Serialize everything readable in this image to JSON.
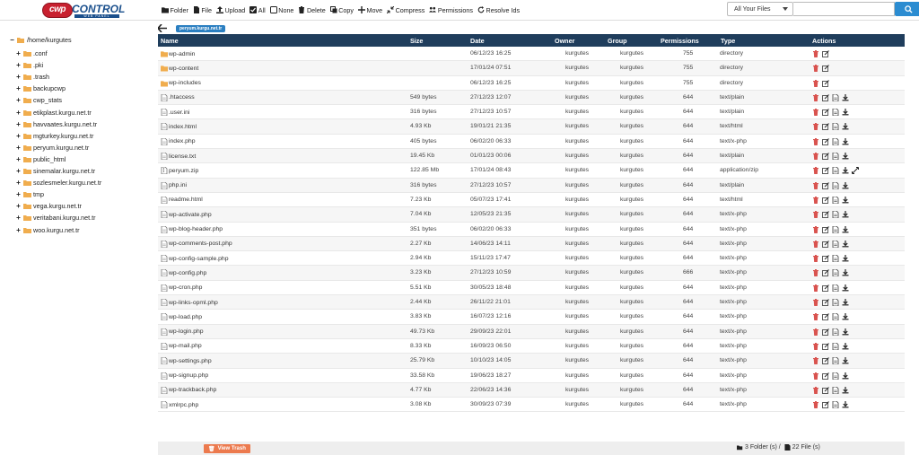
{
  "brand": {
    "badge": "cwp",
    "word": "CONTROL",
    "tagline": "WEB PANEL"
  },
  "toolbar": {
    "items": [
      {
        "label": "Folder",
        "icon": "folder-icon"
      },
      {
        "label": "File",
        "icon": "file-icon"
      },
      {
        "label": "Upload",
        "icon": "upload-icon"
      },
      {
        "label": "All",
        "icon": "checkbox-checked-icon"
      },
      {
        "label": "None",
        "icon": "checkbox-empty-icon"
      },
      {
        "label": "Delete",
        "icon": "trash-icon"
      },
      {
        "label": "Copy",
        "icon": "copy-icon"
      },
      {
        "label": "Move",
        "icon": "move-icon"
      },
      {
        "label": "Compress",
        "icon": "compress-icon"
      },
      {
        "label": "Permissions",
        "icon": "users-icon"
      },
      {
        "label": "Resolve Ids",
        "icon": "refresh-icon"
      }
    ]
  },
  "search": {
    "scope": "All Your Files",
    "value": "",
    "placeholder": ""
  },
  "tree": {
    "root": "/home/kurgutes",
    "items": [
      ".conf",
      ".pki",
      ".trash",
      "backupcwp",
      "cwp_stats",
      "etikplast.kurgu.net.tr",
      "havvaates.kurgu.net.tr",
      "mgturkey.kurgu.net.tr",
      "peryum.kurgu.net.tr",
      "public_html",
      "sinemalar.kurgu.net.tr",
      "sozlesmeler.kurgu.net.tr",
      "tmp",
      "vega.kurgu.net.tr",
      "veritabani.kurgu.net.tr",
      "woo.kurgu.net.tr"
    ]
  },
  "path": {
    "current": "peryum.kurgu.net.tr"
  },
  "table": {
    "headers": {
      "name": "Name",
      "size": "Size",
      "date": "Date",
      "owner": "Owner",
      "group": "Group",
      "permissions": "Permissions",
      "type": "Type",
      "actions": "Actions"
    },
    "rows": [
      {
        "name": "wp-admin",
        "size": "",
        "date": "06/12/23 16:25",
        "owner": "kurgutes",
        "group": "kurgutes",
        "perm": "755",
        "type": "directory",
        "kind": "dir"
      },
      {
        "name": "wp-content",
        "size": "",
        "date": "17/01/24 07:51",
        "owner": "kurgutes",
        "group": "kurgutes",
        "perm": "755",
        "type": "directory",
        "kind": "dir"
      },
      {
        "name": "wp-includes",
        "size": "",
        "date": "06/12/23 16:25",
        "owner": "kurgutes",
        "group": "kurgutes",
        "perm": "755",
        "type": "directory",
        "kind": "dir"
      },
      {
        "name": ".htaccess",
        "size": "549 bytes",
        "date": "27/12/23 12:07",
        "owner": "kurgutes",
        "group": "kurgutes",
        "perm": "644",
        "type": "text/plain",
        "kind": "file"
      },
      {
        "name": ".user.ini",
        "size": "316 bytes",
        "date": "27/12/23 10:57",
        "owner": "kurgutes",
        "group": "kurgutes",
        "perm": "644",
        "type": "text/plain",
        "kind": "file"
      },
      {
        "name": "index.html",
        "size": "4.93 Kb",
        "date": "19/01/21 21:35",
        "owner": "kurgutes",
        "group": "kurgutes",
        "perm": "644",
        "type": "text/html",
        "kind": "file"
      },
      {
        "name": "index.php",
        "size": "405 bytes",
        "date": "06/02/20 06:33",
        "owner": "kurgutes",
        "group": "kurgutes",
        "perm": "644",
        "type": "text/x-php",
        "kind": "file"
      },
      {
        "name": "license.txt",
        "size": "19.45 Kb",
        "date": "01/01/23 00:06",
        "owner": "kurgutes",
        "group": "kurgutes",
        "perm": "644",
        "type": "text/plain",
        "kind": "file"
      },
      {
        "name": "peryum.zip",
        "size": "122.85 Mb",
        "date": "17/01/24 08:43",
        "owner": "kurgutes",
        "group": "kurgutes",
        "perm": "644",
        "type": "application/zip",
        "kind": "zip"
      },
      {
        "name": "php.ini",
        "size": "316 bytes",
        "date": "27/12/23 10:57",
        "owner": "kurgutes",
        "group": "kurgutes",
        "perm": "644",
        "type": "text/plain",
        "kind": "file"
      },
      {
        "name": "readme.html",
        "size": "7.23 Kb",
        "date": "05/07/23 17:41",
        "owner": "kurgutes",
        "group": "kurgutes",
        "perm": "644",
        "type": "text/html",
        "kind": "file"
      },
      {
        "name": "wp-activate.php",
        "size": "7.04 Kb",
        "date": "12/05/23 21:35",
        "owner": "kurgutes",
        "group": "kurgutes",
        "perm": "644",
        "type": "text/x-php",
        "kind": "file"
      },
      {
        "name": "wp-blog-header.php",
        "size": "351 bytes",
        "date": "06/02/20 06:33",
        "owner": "kurgutes",
        "group": "kurgutes",
        "perm": "644",
        "type": "text/x-php",
        "kind": "file"
      },
      {
        "name": "wp-comments-post.php",
        "size": "2.27 Kb",
        "date": "14/06/23 14:11",
        "owner": "kurgutes",
        "group": "kurgutes",
        "perm": "644",
        "type": "text/x-php",
        "kind": "file"
      },
      {
        "name": "wp-config-sample.php",
        "size": "2.94 Kb",
        "date": "15/11/23 17:47",
        "owner": "kurgutes",
        "group": "kurgutes",
        "perm": "644",
        "type": "text/x-php",
        "kind": "file"
      },
      {
        "name": "wp-config.php",
        "size": "3.23 Kb",
        "date": "27/12/23 10:59",
        "owner": "kurgutes",
        "group": "kurgutes",
        "perm": "666",
        "type": "text/x-php",
        "kind": "file"
      },
      {
        "name": "wp-cron.php",
        "size": "5.51 Kb",
        "date": "30/05/23 18:48",
        "owner": "kurgutes",
        "group": "kurgutes",
        "perm": "644",
        "type": "text/x-php",
        "kind": "file"
      },
      {
        "name": "wp-links-opml.php",
        "size": "2.44 Kb",
        "date": "26/11/22 21:01",
        "owner": "kurgutes",
        "group": "kurgutes",
        "perm": "644",
        "type": "text/x-php",
        "kind": "file"
      },
      {
        "name": "wp-load.php",
        "size": "3.83 Kb",
        "date": "16/07/23 12:16",
        "owner": "kurgutes",
        "group": "kurgutes",
        "perm": "644",
        "type": "text/x-php",
        "kind": "file"
      },
      {
        "name": "wp-login.php",
        "size": "49.73 Kb",
        "date": "29/09/23 22:01",
        "owner": "kurgutes",
        "group": "kurgutes",
        "perm": "644",
        "type": "text/x-php",
        "kind": "file"
      },
      {
        "name": "wp-mail.php",
        "size": "8.33 Kb",
        "date": "16/09/23 06:50",
        "owner": "kurgutes",
        "group": "kurgutes",
        "perm": "644",
        "type": "text/x-php",
        "kind": "file"
      },
      {
        "name": "wp-settings.php",
        "size": "25.79 Kb",
        "date": "10/10/23 14:05",
        "owner": "kurgutes",
        "group": "kurgutes",
        "perm": "644",
        "type": "text/x-php",
        "kind": "file"
      },
      {
        "name": "wp-signup.php",
        "size": "33.58 Kb",
        "date": "19/06/23 18:27",
        "owner": "kurgutes",
        "group": "kurgutes",
        "perm": "644",
        "type": "text/x-php",
        "kind": "file"
      },
      {
        "name": "wp-trackback.php",
        "size": "4.77 Kb",
        "date": "22/06/23 14:36",
        "owner": "kurgutes",
        "group": "kurgutes",
        "perm": "644",
        "type": "text/x-php",
        "kind": "file"
      },
      {
        "name": "xmlrpc.php",
        "size": "3.08 Kb",
        "date": "30/09/23 07:39",
        "owner": "kurgutes",
        "group": "kurgutes",
        "perm": "644",
        "type": "text/x-php",
        "kind": "file"
      }
    ]
  },
  "footer": {
    "trash_label": "View Trash",
    "folders": "3 Folder (s)",
    "separator": "/",
    "files": "22 File (s)"
  },
  "colors": {
    "header_bg": "#1f3d5c",
    "accent": "#2b8cd1",
    "folder": "#f0ad4e",
    "trash_button": "#ec7a4e",
    "delete_icon": "#d9534f"
  }
}
